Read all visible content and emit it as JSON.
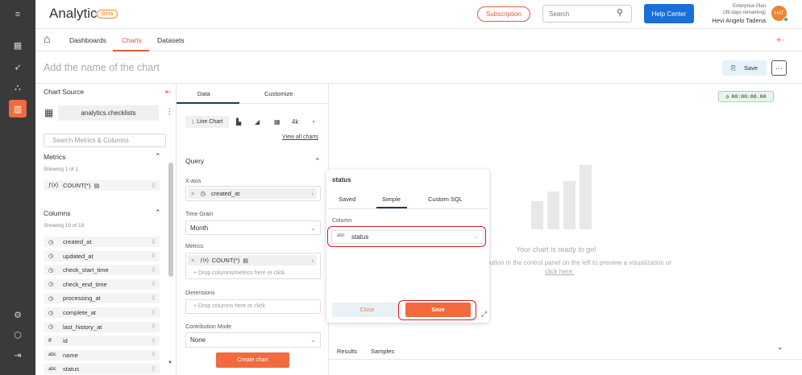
{
  "header": {
    "app_name": "Analytics",
    "beta": "Beta",
    "subscription": "Subscription",
    "search_placeholder": "Search",
    "help_center": "Help Center",
    "plan_line1": "Enterprise Plan",
    "plan_line2": "(39 days remaining)",
    "user_name": "Hevi Angelo Tadena",
    "avatar_initials": "HAT"
  },
  "tabs": [
    "Dashboards",
    "Charts",
    "Datasets"
  ],
  "title_bar": {
    "placeholder": "Add the name of the chart",
    "save": "Save"
  },
  "left": {
    "chart_source": "Chart Source",
    "dataset": "analytics.checklists",
    "search_placeholder": "Search Metrics & Columns",
    "metrics_title": "Metrics",
    "metrics_showing": "Showing 1 of 1",
    "metric": "COUNT(*)",
    "columns_title": "Columns",
    "columns_showing": "Showing 19 of 19",
    "columns": [
      {
        "icon": "◷",
        "name": "created_at"
      },
      {
        "icon": "◷",
        "name": "updated_at"
      },
      {
        "icon": "◷",
        "name": "check_start_time"
      },
      {
        "icon": "◷",
        "name": "check_end_time"
      },
      {
        "icon": "◷",
        "name": "processing_at"
      },
      {
        "icon": "◷",
        "name": "complete_at"
      },
      {
        "icon": "◷",
        "name": "last_history_at"
      },
      {
        "icon": "#",
        "name": "id"
      },
      {
        "icon": "abc",
        "name": "name"
      },
      {
        "icon": "abc",
        "name": "status"
      }
    ]
  },
  "mid": {
    "tab_data": "Data",
    "tab_customize": "Customize",
    "line_chart": "Line Chart",
    "k4": "4k",
    "view_all": "View all charts",
    "query": "Query",
    "xaxis_label": "X-axis",
    "xaxis_value": "created_at",
    "time_grain_label": "Time Grain",
    "time_grain_value": "Month",
    "metrics_label": "Metrics",
    "metrics_value": "COUNT(*)",
    "metrics_drop": "Drop columns/metrics here or click",
    "dimensions_label": "Dimensions",
    "dimensions_drop": "Drop columns here or click",
    "contribution_label": "Contribution Mode",
    "contribution_value": "None",
    "create_chart": "Create chart"
  },
  "right": {
    "timer": "00:00:00.00",
    "ready": "Your chart is ready to go!",
    "desc": "t\" button in the control panel on the left to preview a visualization or",
    "click_here": "click here.",
    "results": "Results",
    "samples": "Samples"
  },
  "popover": {
    "title": "status",
    "tab_saved": "Saved",
    "tab_simple": "Simple",
    "tab_custom": "Custom SQL",
    "column_label": "Column",
    "column_type": "abc",
    "column_value": "status",
    "close": "Close",
    "save": "Save"
  },
  "colors": {
    "accent": "#f26a3d",
    "primary": "#1a6fdb",
    "sidebar": "#3a3a3a"
  }
}
